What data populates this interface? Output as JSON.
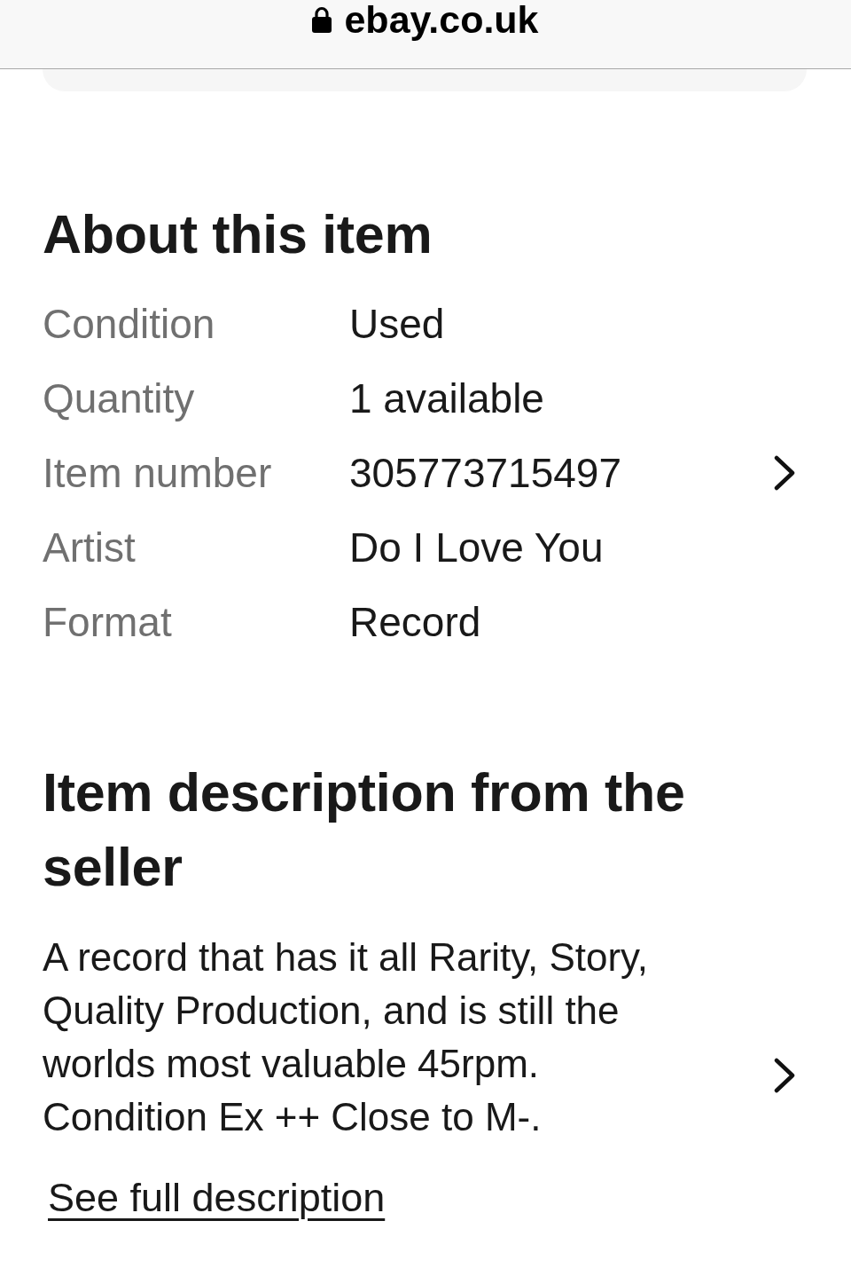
{
  "address_bar": {
    "url": "ebay.co.uk",
    "secure": true
  },
  "about": {
    "title": "About this item",
    "rows": [
      {
        "label": "Condition",
        "value": "Used",
        "navigable": false
      },
      {
        "label": "Quantity",
        "value": "1 available",
        "navigable": false
      },
      {
        "label": "Item number",
        "value": "305773715497",
        "navigable": true
      },
      {
        "label": "Artist",
        "value": "Do I Love You",
        "navigable": false
      },
      {
        "label": "Format",
        "value": "Record",
        "navigable": false
      }
    ]
  },
  "description": {
    "title": "Item description from the seller",
    "text": "A record that has it all Rarity, Story, Quality Production, and is still the worlds most valuable 45rpm. Condition Ex ++ Close to M-.",
    "navigable": true,
    "link": "See full description"
  }
}
